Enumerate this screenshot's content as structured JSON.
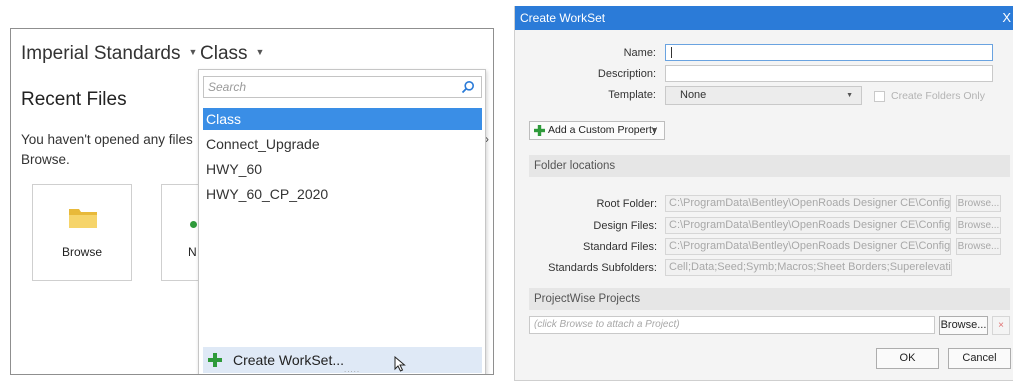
{
  "left_panel": {
    "standards_selector": "Imperial Standards",
    "workset_selector": "Class",
    "recent_title": "Recent Files",
    "recent_message": "You haven't opened any files",
    "recent_message_2": "Browse.",
    "browse_tile_label": "Browse",
    "new_tile_label": "N",
    "dropdown": {
      "search_placeholder": "Search",
      "items": [
        "Class",
        "Connect_Upgrade",
        "HWY_60",
        "HWY_60_CP_2020"
      ],
      "selected": "Class",
      "create_label": "Create WorkSet...",
      "grip": "....."
    }
  },
  "dialog": {
    "title": "Create WorkSet",
    "close_glyph": "X",
    "fields": {
      "name_label": "Name:",
      "name_value": "",
      "description_label": "Description:",
      "description_value": "",
      "template_label": "Template:",
      "template_value": "None",
      "create_folders_label": "Create Folders Only"
    },
    "add_property_label": "Add a Custom Property",
    "folder_section_title": "Folder locations",
    "folders": [
      {
        "label": "Root Folder:",
        "value": "C:\\ProgramData\\Bentley\\OpenRoads Designer CE\\Configuration\\W",
        "browse": "Browse..."
      },
      {
        "label": "Design Files:",
        "value": "C:\\ProgramData\\Bentley\\OpenRoads Designer CE\\Configuration\\W",
        "browse": "Browse..."
      },
      {
        "label": "Standard Files:",
        "value": "C:\\ProgramData\\Bentley\\OpenRoads Designer CE\\Configuration\\W",
        "browse": "Browse..."
      },
      {
        "label": "Standards Subfolders:",
        "value": "Cell;Data;Seed;Symb;Macros;Sheet Borders;Superelevation;Templat"
      }
    ],
    "projectwise_title": "ProjectWise Projects",
    "projectwise_placeholder": "(click Browse to attach a Project)",
    "projectwise_browse": "Browse...",
    "projectwise_remove": "×",
    "ok_label": "OK",
    "cancel_label": "Cancel"
  },
  "colors": {
    "accent": "#3a8ee6",
    "titlebar": "#2b7bd8",
    "plus_green": "#2e9a3a",
    "folder_yellow": "#f2c94c"
  }
}
